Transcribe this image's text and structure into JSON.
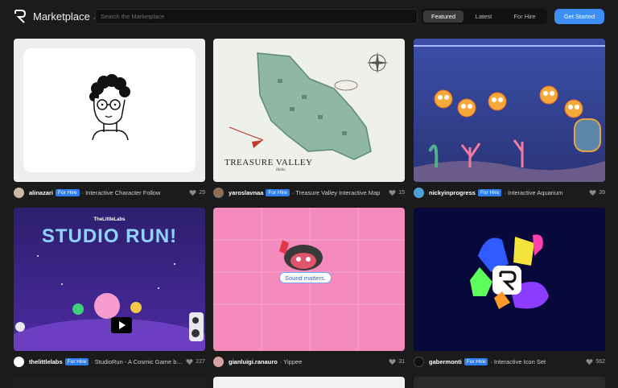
{
  "brand": {
    "name": "Marketplace"
  },
  "search": {
    "placeholder": "Search the Marketplace"
  },
  "tabs": [
    {
      "label": "Featured"
    },
    {
      "label": "Latest"
    },
    {
      "label": "For Hire"
    }
  ],
  "cta": {
    "label": "Get Started"
  },
  "cards": [
    {
      "author": "alinazari",
      "badge": "For Hire",
      "title": "· Interactive Character Follow",
      "likes": "29"
    },
    {
      "author": "yaroslavnaa",
      "badge": "For Hire",
      "title": "· Treasure Valley Interactive Map",
      "likes": "15",
      "map_title": "TREASURE VALLEY",
      "map_subtitle": "Idaho"
    },
    {
      "author": "nickyinprogress",
      "badge": "For Hire",
      "title": "· Interactive Aquarium",
      "likes": "39"
    },
    {
      "author": "thelittlelabs",
      "badge": "For Hire",
      "title": "· StudioRun - A Cosmic Game by ...",
      "likes": "227",
      "logo_small": "TheLittleLabs",
      "logo_big": "STUDIO RUN!"
    },
    {
      "author": "gianluigi.ranauro",
      "badge": "",
      "title": "· Yippee",
      "likes": "31",
      "bubble": "Sound matters."
    },
    {
      "author": "gabermonti",
      "badge": "For Hire",
      "title": "· Interactive Icon Set",
      "likes": "562"
    }
  ],
  "colors": {
    "accent": "#3d8ef5",
    "badge": "#2d7ff0",
    "background": "#1b1b1b"
  }
}
